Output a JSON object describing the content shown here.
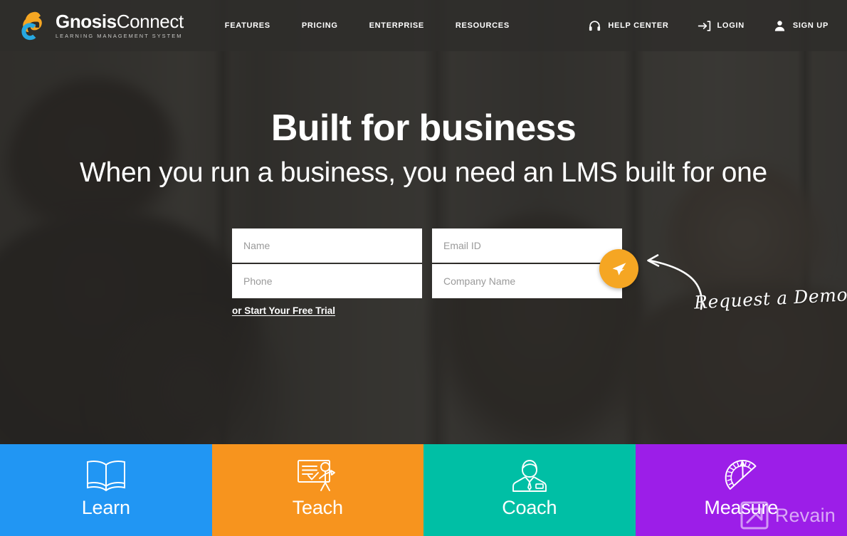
{
  "brand": {
    "name_bold": "Gnosis",
    "name_light": "Connect",
    "tagline": "LEARNING MANAGEMENT SYSTEM",
    "logo_icon": "gnosis-gc-logo-icon",
    "logo_orange": "#F5A623",
    "logo_blue": "#27A8E0"
  },
  "nav": {
    "items": [
      {
        "label": "FEATURES",
        "name": "nav-link-features"
      },
      {
        "label": "PRICING",
        "name": "nav-link-pricing"
      },
      {
        "label": "ENTERPRISE",
        "name": "nav-link-enterprise"
      },
      {
        "label": "RESOURCES",
        "name": "nav-link-resources"
      }
    ],
    "utilities": [
      {
        "label": "HELP CENTER",
        "icon": "headset-icon",
        "name": "nav-help-center"
      },
      {
        "label": "LOGIN",
        "icon": "login-arrow-icon",
        "name": "nav-login"
      },
      {
        "label": "SIGN UP",
        "icon": "person-icon",
        "name": "nav-sign-up"
      }
    ]
  },
  "hero": {
    "title": "Built for business",
    "subtitle": "When you run a business, you need an LMS built for one",
    "background": "office-photo-darkened"
  },
  "form": {
    "fields": [
      {
        "placeholder": "Name",
        "value": "",
        "name": "name-input"
      },
      {
        "placeholder": "Email ID",
        "value": "",
        "name": "email-input"
      },
      {
        "placeholder": "Phone",
        "value": "",
        "name": "phone-input"
      },
      {
        "placeholder": "Company Name",
        "value": "",
        "name": "company-name-input"
      }
    ],
    "submit_icon": "paper-plane-send-icon",
    "submit_color": "#F5A623",
    "trial_link": "or Start Your Free Trial",
    "annotation": "Request a Demo",
    "annotation_arrow": "curved-arrow-icon"
  },
  "tiles": [
    {
      "label": "Learn",
      "icon": "open-book-icon",
      "color": "#2196F3",
      "name": "tile-learn"
    },
    {
      "label": "Teach",
      "icon": "whiteboard-presenter-icon",
      "color": "#F7941E",
      "name": "tile-teach"
    },
    {
      "label": "Coach",
      "icon": "person-suit-icon",
      "color": "#00BFA5",
      "name": "tile-coach"
    },
    {
      "label": "Measure",
      "icon": "protractor-gauge-icon",
      "color": "#9C1EE8",
      "name": "tile-measure"
    }
  ],
  "watermark": {
    "text": "Revain",
    "icon": "revain-logo-icon"
  }
}
